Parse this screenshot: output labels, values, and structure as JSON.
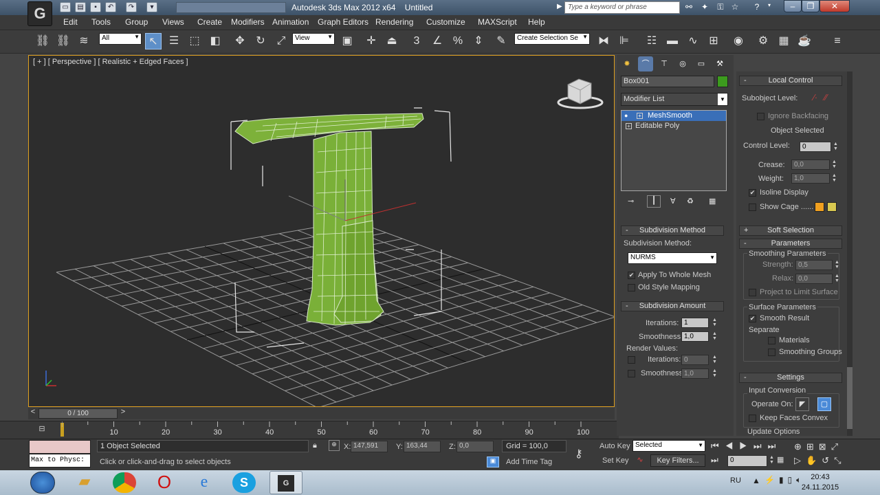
{
  "app": {
    "title": "Autodesk 3ds Max  2012 x64",
    "file": "Untitled"
  },
  "search": {
    "placeholder": "Type a keyword or phrase"
  },
  "menu": [
    "Edit",
    "Tools",
    "Group",
    "Views",
    "Create",
    "Modifiers",
    "Animation",
    "Graph Editors",
    "Rendering",
    "Customize",
    "MAXScript",
    "Help"
  ],
  "toolbar": {
    "filter": "All",
    "refcoord": "View",
    "selset": "Create Selection Se"
  },
  "viewport": {
    "label": "[ + ] [ Perspective ] [ Realistic + Edged Faces ]"
  },
  "modifier": {
    "object_name": "Box001",
    "object_color": "#3c9b1e",
    "list_label": "Modifier List",
    "stack": [
      {
        "name": "MeshSmooth",
        "selected": true
      },
      {
        "name": "Editable Poly",
        "selected": false
      }
    ]
  },
  "subdivision": {
    "method_title": "Subdivision Method",
    "method_label": "Subdivision Method:",
    "method_value": "NURMS",
    "apply_whole": "Apply To Whole Mesh",
    "old_style": "Old Style Mapping",
    "amount_title": "Subdivision Amount",
    "iterations_label": "Iterations:",
    "iterations": "1",
    "smoothness_label": "Smoothness:",
    "smoothness": "1,0",
    "render_values": "Render Values:",
    "r_iterations_label": "Iterations:",
    "r_iterations": "0",
    "r_smoothness_label": "Smoothness:",
    "r_smoothness": "1,0"
  },
  "local": {
    "title": "Local Control",
    "subobject": "Subobject Level:",
    "ignore_backfacing": "Ignore Backfacing",
    "object_selected": "Object Selected",
    "control_level_label": "Control Level:",
    "control_level": "0",
    "crease_label": "Crease:",
    "crease": "0,0",
    "weight_label": "Weight:",
    "weight": "1,0",
    "isoline": "Isoline Display",
    "show_cage": "Show Cage ......",
    "cage_color1": "#f0a020",
    "cage_color2": "#d8c850"
  },
  "soft_selection": {
    "title": "Soft Selection"
  },
  "parameters": {
    "title": "Parameters",
    "smoothing_params": "Smoothing Parameters",
    "strength_label": "Strength:",
    "strength": "0,5",
    "relax_label": "Relax:",
    "relax": "0,0",
    "project_limit": "Project to Limit Surface",
    "surface_params": "Surface Parameters",
    "smooth_result": "Smooth Result",
    "separate": "Separate",
    "materials": "Materials",
    "smoothing_groups": "Smoothing Groups"
  },
  "settings": {
    "title": "Settings",
    "input_conversion": "Input Conversion",
    "operate_on": "Operate On:",
    "keep_convex": "Keep Faces Convex",
    "update_options": "Update Options"
  },
  "timeline": {
    "frame": "0 / 100",
    "ticks": [
      "0",
      "10",
      "20",
      "30",
      "40",
      "50",
      "60",
      "70",
      "80",
      "90",
      "100"
    ]
  },
  "status": {
    "script_field": "Max to Physc:",
    "selected": "1 Object Selected",
    "prompt": "Click or click-and-drag to select objects",
    "x_label": "X:",
    "x": "147,591",
    "y_label": "Y:",
    "y": "163,44",
    "z_label": "Z:",
    "z": "0,0",
    "grid": "Grid = 100,0",
    "add_time_tag": "Add Time Tag",
    "auto_key": "Auto Key",
    "set_key": "Set Key",
    "selected_dd": "Selected",
    "key_filters": "Key Filters...",
    "frame_field": "0"
  },
  "taskbar": {
    "lang": "RU",
    "time": "20:43",
    "date": "24.11.2015"
  }
}
